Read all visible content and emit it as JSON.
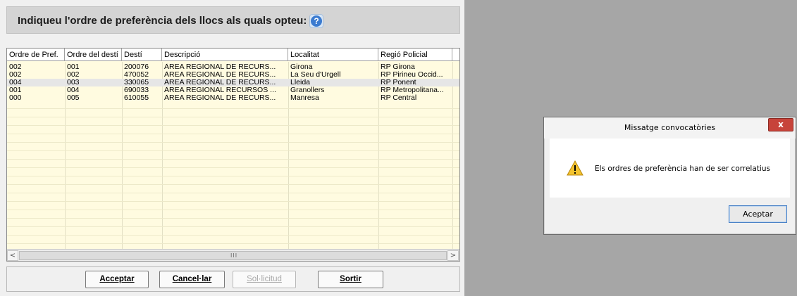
{
  "header": {
    "title": "Indiqueu l'ordre de preferència dels llocs als quals opteu:",
    "help_icon": "question-mark-icon",
    "help_glyph": "?"
  },
  "grid": {
    "columns": [
      "Ordre de Pref.",
      "Ordre del destí",
      "Destí",
      "Descripció",
      "Localitat",
      "Regió Policial"
    ],
    "rows": [
      [
        "002",
        "001",
        "200076",
        "ÀREA REGIONAL DE RECURS...",
        "Girona",
        "RP Girona"
      ],
      [
        "002",
        "002",
        "470052",
        "ÀREA REGIONAL DE RECURS...",
        "La  Seu d'Urgell",
        "RP Pirineu Occid..."
      ],
      [
        "004",
        "003",
        "330065",
        "ÀREA REGIONAL DE RECURS...",
        "Lleida",
        "RP Ponent"
      ],
      [
        "001",
        "004",
        "690033",
        "ÀREA REGIONAL RECURSOS ...",
        "Granollers",
        "RP  Metropolitana..."
      ],
      [
        "000",
        "005",
        "610055",
        "ÀREA REGIONAL DE RECURS...",
        "Manresa",
        "RP Central"
      ]
    ],
    "selected_row_index": 2,
    "scroll_left_glyph": "<",
    "scroll_right_glyph": ">",
    "scroll_grip": "III"
  },
  "buttons": {
    "accept": "Acceptar",
    "cancel": "Cancel·lar",
    "request": "Sol·licitud",
    "exit": "Sortir"
  },
  "dialog": {
    "title": "Missatge convocatòries",
    "close_glyph": "x",
    "message": "Els ordres de preferència han de ser correlatius",
    "ok_button": "Aceptar",
    "icon": "warning-icon"
  },
  "colors": {
    "grid_background": "#fffbe0",
    "selected_row": "#e6e6e6",
    "backdrop": "#a6a6a6",
    "close_button": "#c7433a"
  }
}
